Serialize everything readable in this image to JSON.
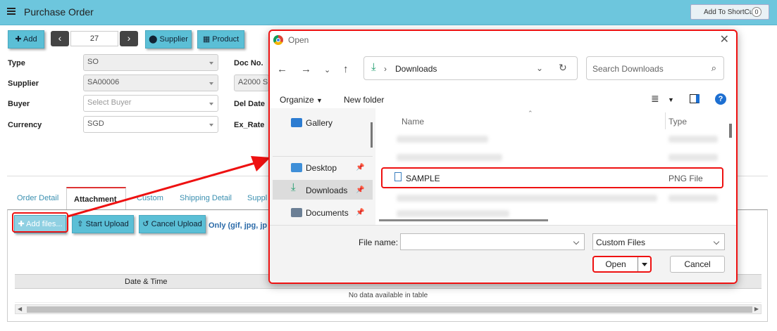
{
  "header": {
    "title": "Purchase Order",
    "shortcut_label": "Add To ShortCut",
    "shortcut_count": "0"
  },
  "toolbar": {
    "add_label": "✚ Add",
    "record_number": "27",
    "supplier_label": "Supplier",
    "product_label": "Product"
  },
  "form": {
    "type_label": "Type",
    "type_value": "SO",
    "supplier_label": "Supplier",
    "supplier_value": "SA00006",
    "buyer_label": "Buyer",
    "buyer_placeholder": "Select Buyer",
    "currency_label": "Currency",
    "currency_value": "SGD",
    "doc_no_label": "Doc No.",
    "doc_no_value": "A2000 S",
    "del_date_label": "Del Date",
    "ex_rate_label": "Ex_Rate"
  },
  "tabs": [
    "Order Detail",
    "Attachment",
    "Custom",
    "Shipping Detail",
    "Suppl"
  ],
  "attachment": {
    "add_files": "✚ Add files...",
    "start_upload": "Start Upload",
    "cancel_upload": "Cancel Upload",
    "hint": "Only (gif, jpg, jp",
    "column_date": "Date & Time",
    "empty": "No data available in table"
  },
  "dialog": {
    "title": "Open",
    "path": "Downloads",
    "search_placeholder": "Search Downloads",
    "organize": "Organize",
    "new_folder": "New folder",
    "sidebar": [
      "Gallery",
      "Desktop",
      "Downloads",
      "Documents"
    ],
    "col_name": "Name",
    "col_type": "Type",
    "file": {
      "name": "SAMPLE",
      "type": "PNG File"
    },
    "file_name_label": "File name:",
    "file_name_value": "",
    "filter": "Custom Files",
    "open": "Open",
    "cancel": "Cancel"
  },
  "colors": {
    "header": "#6dc6dd",
    "button": "#5bbfd6",
    "highlight": "#e11111"
  }
}
